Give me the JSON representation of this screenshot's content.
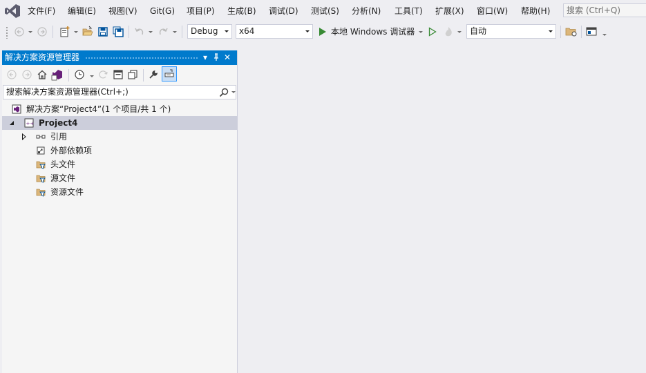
{
  "menubar": {
    "items": [
      {
        "label": "文件(F)"
      },
      {
        "label": "编辑(E)"
      },
      {
        "label": "视图(V)"
      },
      {
        "label": "Git(G)"
      },
      {
        "label": "项目(P)"
      },
      {
        "label": "生成(B)"
      },
      {
        "label": "调试(D)"
      },
      {
        "label": "测试(S)"
      },
      {
        "label": "分析(N)"
      },
      {
        "label": "工具(T)"
      },
      {
        "label": "扩展(X)"
      },
      {
        "label": "窗口(W)"
      },
      {
        "label": "帮助(H)"
      }
    ],
    "search_placeholder": "搜索 (Ctrl+Q)"
  },
  "toolbar": {
    "configuration": "Debug",
    "platform": "x64",
    "run_target": "本地 Windows 调试器",
    "auto_combo": "自动"
  },
  "explorer": {
    "title": "解决方案资源管理器",
    "search_placeholder": "搜索解决方案资源管理器(Ctrl+;)",
    "tree": {
      "solution": "解决方案“Project4”(1 个项目/共 1 个)",
      "project": "Project4",
      "children": [
        {
          "label": "引用",
          "icon": "references-icon"
        },
        {
          "label": "外部依赖项",
          "icon": "external-dependencies-icon"
        },
        {
          "label": "头文件",
          "icon": "filter-folder-icon"
        },
        {
          "label": "源文件",
          "icon": "filter-folder-icon"
        },
        {
          "label": "资源文件",
          "icon": "filter-folder-icon"
        }
      ]
    }
  },
  "colors": {
    "accent": "#007acc",
    "chrome": "#eeeef2",
    "panel": "#f5f5f5",
    "selection": "#cccedb",
    "vs_purple": "#68217a",
    "run_green": "#388a34",
    "folder_yellow": "#dcb67a"
  }
}
